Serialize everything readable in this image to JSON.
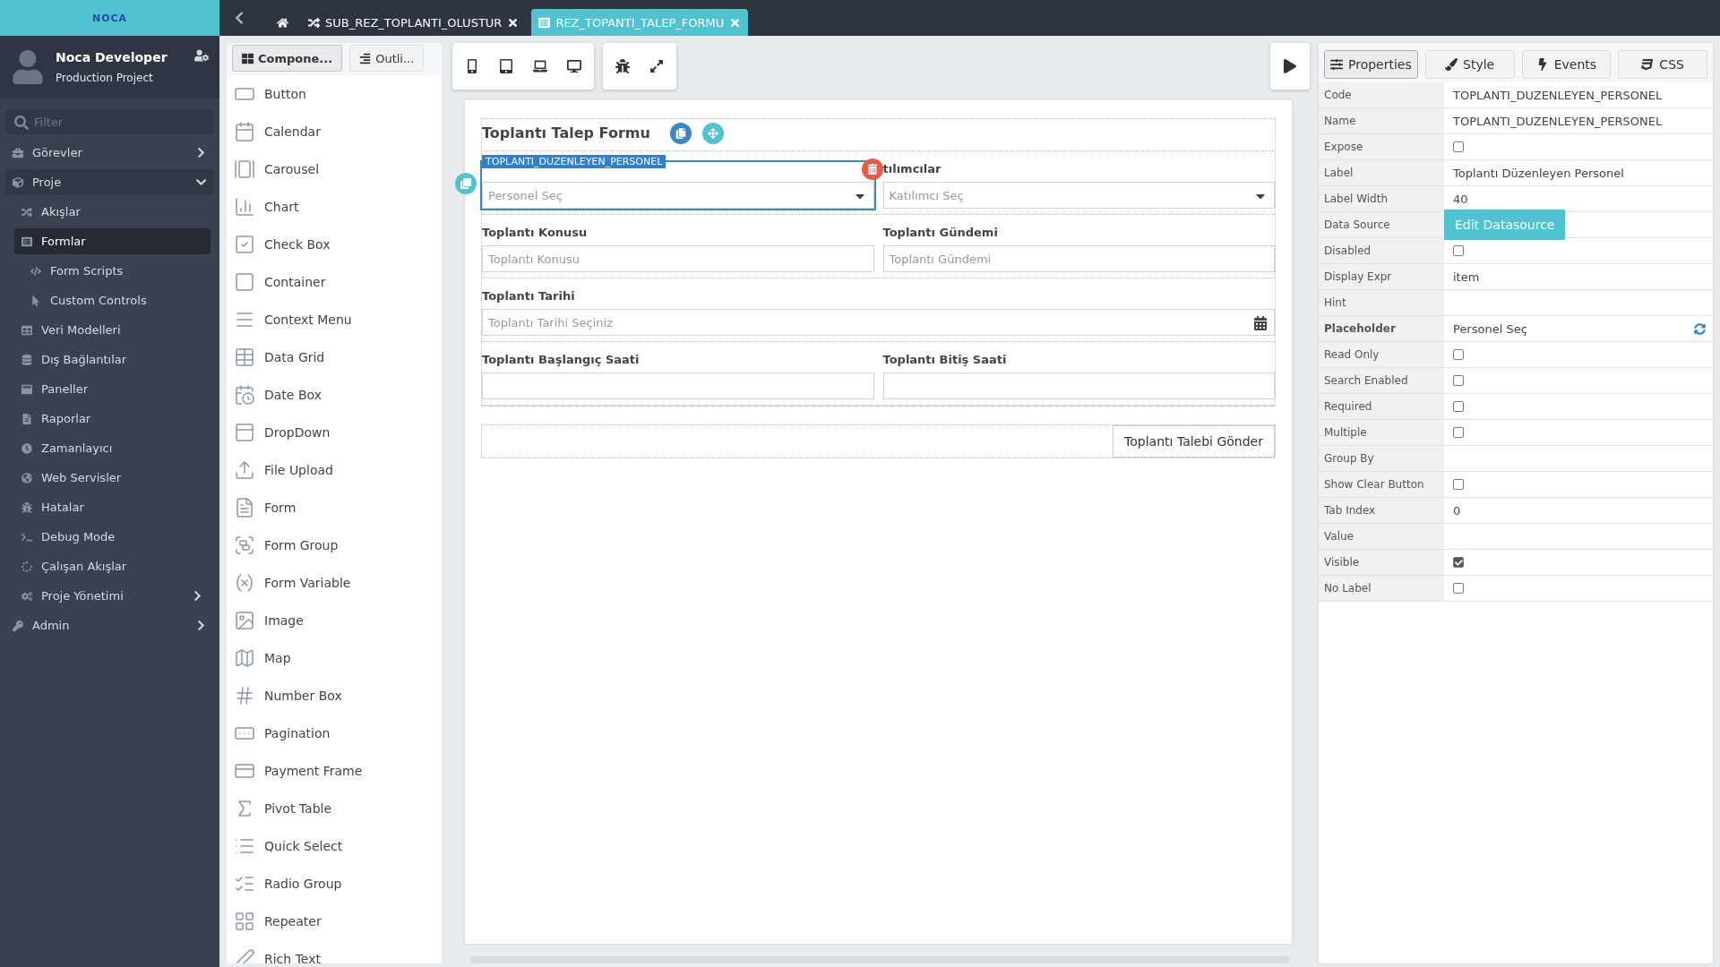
{
  "brand": {
    "logo": "NOCA"
  },
  "user": {
    "name": "Noca Developer",
    "project": "Production Project"
  },
  "sidebar": {
    "filter_placeholder": "Filter",
    "items": [
      {
        "label": "Görevler",
        "selected": false,
        "expanded": false
      },
      {
        "label": "Proje",
        "selected": false,
        "expanded": true,
        "children": [
          {
            "label": "Akışlar",
            "selected": false
          },
          {
            "label": "Formlar",
            "selected": true,
            "children": [
              {
                "label": "Form Scripts",
                "selected": false
              },
              {
                "label": "Custom Controls",
                "selected": false
              }
            ]
          },
          {
            "label": "Veri Modelleri",
            "selected": false
          },
          {
            "label": "Dış Bağlantılar",
            "selected": false
          },
          {
            "label": "Paneller",
            "selected": false
          },
          {
            "label": "Raporlar",
            "selected": false
          },
          {
            "label": "Zamanlayıcı",
            "selected": false
          },
          {
            "label": "Web Servisler",
            "selected": false
          },
          {
            "label": "Hatalar",
            "selected": false
          },
          {
            "label": "Debug Mode",
            "selected": false
          },
          {
            "label": "Çalışan Akışlar",
            "selected": false
          },
          {
            "label": "Proje Yönetimi",
            "selected": false,
            "expanded": false
          }
        ]
      },
      {
        "label": "Admin",
        "selected": false,
        "expanded": false
      }
    ]
  },
  "tabs": [
    {
      "label": "SUB_REZ_TOPLANTI_OLUSTUR",
      "selected": false
    },
    {
      "label": "REZ_TOPANTI_TALEP_FORMU",
      "selected": true
    }
  ],
  "left_panel": {
    "tabs": [
      {
        "label": "Compone...",
        "selected": true
      },
      {
        "label": "Outli...",
        "selected": false
      }
    ],
    "components": [
      "Button",
      "Calendar",
      "Carousel",
      "Chart",
      "Check Box",
      "Container",
      "Context Menu",
      "Data Grid",
      "Date Box",
      "DropDown",
      "File Upload",
      "Form",
      "Form Group",
      "Form Variable",
      "Image",
      "Map",
      "Number Box",
      "Pagination",
      "Payment Frame",
      "Pivot Table",
      "Quick Select",
      "Radio Group",
      "Repeater",
      "Rich Text"
    ]
  },
  "form": {
    "title": "Toplantı Talep Formu",
    "selected_chip": "TOPLANTI_DUZENLEYEN_PERSONEL",
    "rows": [
      [
        {
          "kind": "select",
          "placeholder": "Personel Seç",
          "selected": true
        },
        {
          "kind": "select",
          "label": "tılımcılar",
          "placeholder": "Katılımcı Seç",
          "selected": false
        }
      ],
      [
        {
          "kind": "text",
          "label": "Toplantı Konusu",
          "placeholder": "Toplantı Konusu",
          "selected": false
        },
        {
          "kind": "text",
          "label": "Toplantı Gündemi",
          "placeholder": "Toplantı Gündemi",
          "selected": false
        }
      ],
      [
        {
          "kind": "date",
          "label": "Toplantı Tarihi",
          "placeholder": "Toplantı Tarihi Seçiniz",
          "selected": false
        }
      ],
      [
        {
          "kind": "text",
          "label": "Toplantı Başlangıç Saati",
          "selected": false
        },
        {
          "kind": "text",
          "label": "Toplantı Bitiş Saati",
          "selected": false
        }
      ]
    ],
    "submit": "Toplantı Talebi Gönder"
  },
  "properties": {
    "tabs": [
      {
        "label": "Properties",
        "selected": true
      },
      {
        "label": "Style",
        "selected": false
      },
      {
        "label": "Events",
        "selected": false
      },
      {
        "label": "CSS",
        "selected": false
      }
    ],
    "rows": [
      {
        "kind": "text",
        "name": "Code",
        "value": "TOPLANTI_DUZENLEYEN_PERSONEL",
        "modified": false
      },
      {
        "kind": "text",
        "name": "Name",
        "value": "TOPLANTI_DUZENLEYEN_PERSONEL",
        "modified": false
      },
      {
        "kind": "checkbox",
        "name": "Expose",
        "checked": false,
        "modified": false
      },
      {
        "kind": "text",
        "name": "Label",
        "value": "Toplantı Düzenleyen Personel",
        "modified": false
      },
      {
        "kind": "text",
        "name": "Label Width",
        "value": "40",
        "modified": false
      },
      {
        "kind": "button",
        "name": "Data Source",
        "value": "Edit Datasource",
        "modified": false
      },
      {
        "kind": "checkbox",
        "name": "Disabled",
        "checked": false,
        "modified": false
      },
      {
        "kind": "text",
        "name": "Display Expr",
        "value": "item",
        "modified": false
      },
      {
        "kind": "text",
        "name": "Hint",
        "modified": false
      },
      {
        "kind": "text",
        "name": "Placeholder",
        "value": "Personel Seç",
        "modified": true
      },
      {
        "kind": "checkbox",
        "name": "Read Only",
        "checked": false,
        "modified": false
      },
      {
        "kind": "checkbox",
        "name": "Search Enabled",
        "checked": false,
        "modified": false
      },
      {
        "kind": "checkbox",
        "name": "Required",
        "checked": false,
        "modified": false
      },
      {
        "kind": "checkbox",
        "name": "Multiple",
        "checked": false,
        "modified": false
      },
      {
        "kind": "text",
        "name": "Group By",
        "modified": false
      },
      {
        "kind": "checkbox",
        "name": "Show Clear Button",
        "checked": false,
        "modified": false
      },
      {
        "kind": "text",
        "name": "Tab Index",
        "value": "0",
        "modified": false
      },
      {
        "kind": "text",
        "name": "Value",
        "modified": false
      },
      {
        "kind": "checkbox",
        "name": "Visible",
        "checked": true,
        "modified": false
      },
      {
        "kind": "checkbox",
        "name": "No Label",
        "checked": false,
        "modified": false
      }
    ]
  }
}
